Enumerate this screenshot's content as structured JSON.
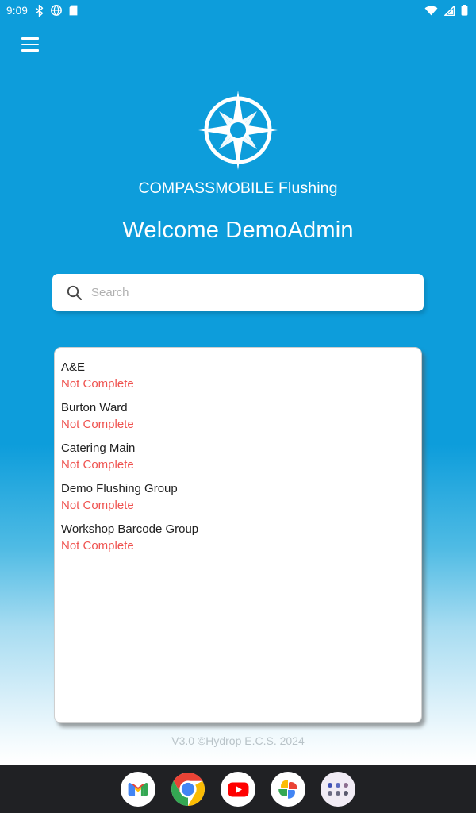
{
  "status_bar": {
    "time": "9:09",
    "left_icons": [
      "bluetooth-icon",
      "vpn-icon",
      "sd-card-icon"
    ],
    "right_icons": [
      "wifi-icon",
      "cellular-signal-icon",
      "battery-icon"
    ]
  },
  "nav": {
    "menu_label": "hamburger-menu"
  },
  "brand": {
    "logo_name": "compass-rose-logo",
    "app_title": "COMPASSMOBILE Flushing",
    "welcome_heading": "Welcome DemoAdmin"
  },
  "search": {
    "placeholder": "Search",
    "value": "",
    "icon": "search-icon"
  },
  "list": {
    "items": [
      {
        "name": "A&E",
        "status": "Not Complete"
      },
      {
        "name": "Burton Ward",
        "status": "Not Complete"
      },
      {
        "name": "Catering Main",
        "status": "Not Complete"
      },
      {
        "name": "Demo Flushing Group",
        "status": "Not Complete"
      },
      {
        "name": "Workshop Barcode Group",
        "status": "Not Complete"
      }
    ]
  },
  "footer": {
    "version_text": "V3.0 ©Hydrop E.C.S. 2024"
  },
  "dock": {
    "apps": [
      {
        "name": "gmail",
        "label": "Gmail"
      },
      {
        "name": "chrome",
        "label": "Chrome"
      },
      {
        "name": "youtube",
        "label": "YouTube"
      },
      {
        "name": "google-photos",
        "label": "Photos"
      },
      {
        "name": "app-drawer",
        "label": "All apps"
      }
    ]
  },
  "colors": {
    "brand_blue": "#0d9ddb",
    "status_red": "#ef5350",
    "card_white": "#ffffff",
    "footer_gray": "#b9c3c8",
    "dock_dark": "#202124"
  }
}
